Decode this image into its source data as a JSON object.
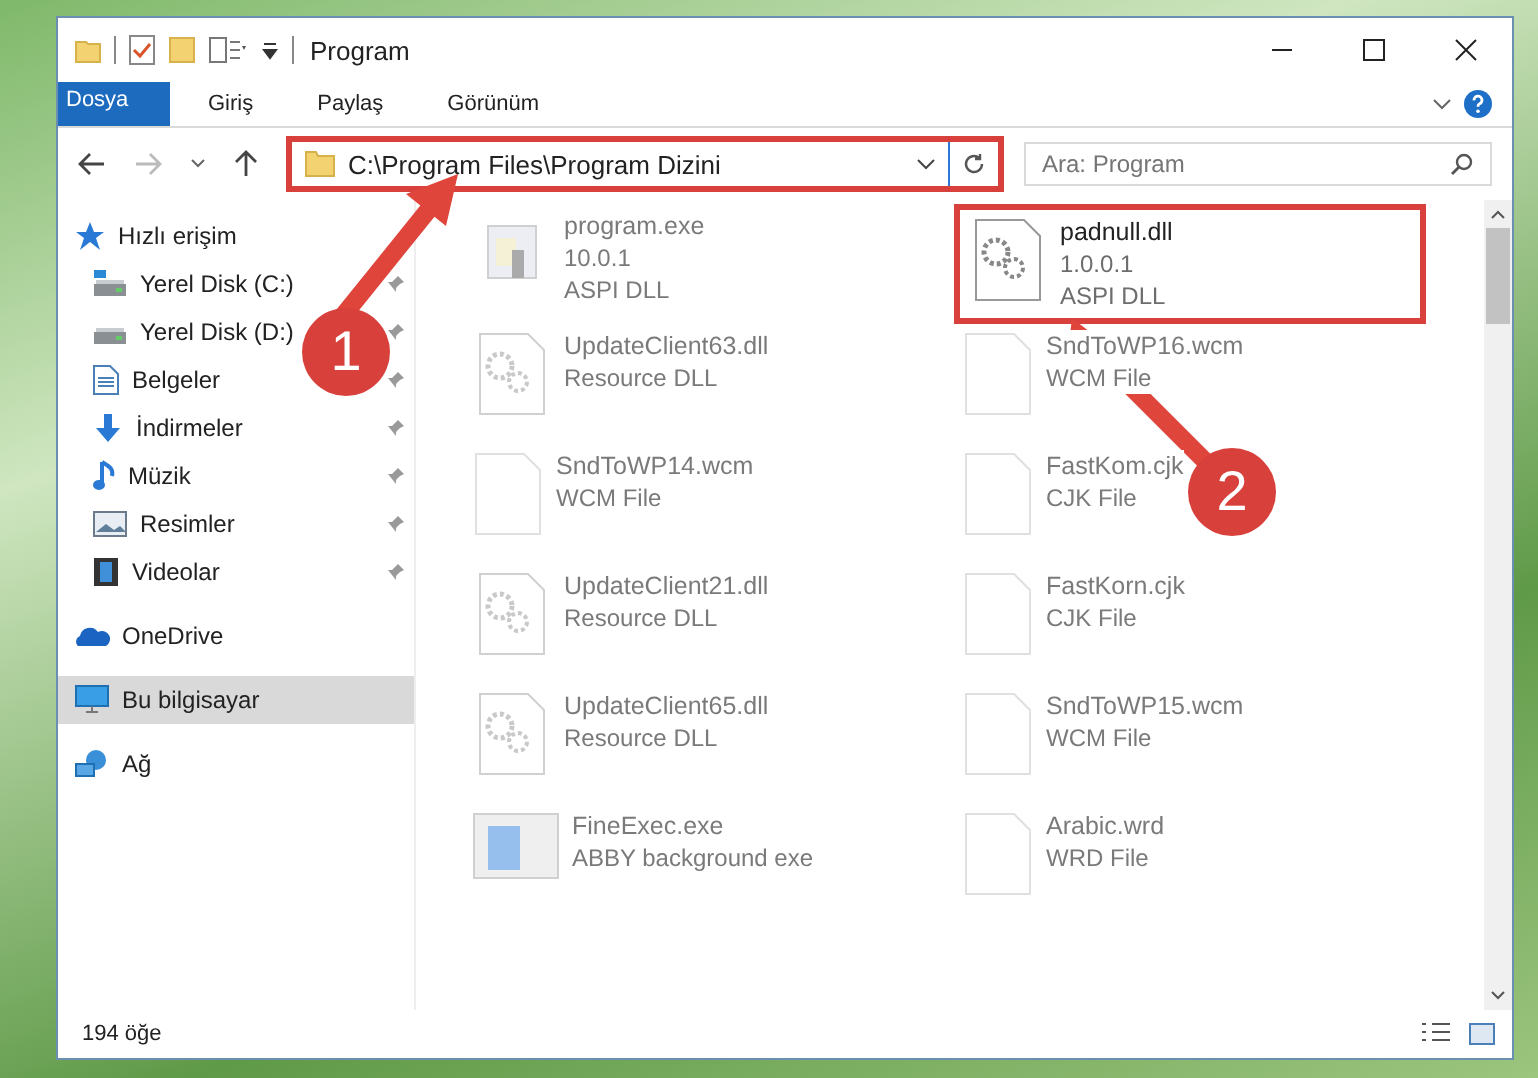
{
  "window": {
    "title": "Program"
  },
  "ribbon_tabs": [
    {
      "label": "Dosya",
      "kind": "file"
    },
    {
      "label": "Giriş",
      "kind": "tab"
    },
    {
      "label": "Paylaş",
      "kind": "tab"
    },
    {
      "label": "Görünüm",
      "kind": "tab"
    }
  ],
  "address_bar": {
    "path": "C:\\Program Files\\Program Dizini",
    "highlighted": true
  },
  "search": {
    "placeholder": "Ara: Program"
  },
  "sidebar": {
    "items": [
      {
        "label": "Hızlı erişim",
        "selected": false,
        "children": [
          {
            "label": "Yerel Disk (C:)",
            "pinned": true
          },
          {
            "label": "Yerel Disk (D:)",
            "pinned": true
          },
          {
            "label": "Belgeler",
            "pinned": true
          },
          {
            "label": "İndirmeler",
            "pinned": true
          },
          {
            "label": "Müzik",
            "pinned": true
          },
          {
            "label": "Resimler",
            "pinned": true
          },
          {
            "label": "Videolar",
            "pinned": true
          }
        ]
      },
      {
        "label": "OneDrive",
        "selected": false
      },
      {
        "label": "Bu bilgisayar",
        "selected": true
      },
      {
        "label": "Ağ",
        "selected": false
      }
    ]
  },
  "files": [
    {
      "name": "program.exe",
      "lines": [
        "10.0.1",
        "ASPI DLL"
      ],
      "kind": "exe",
      "highlighted": false
    },
    {
      "name": "padnull.dll",
      "lines": [
        "1.0.0.1",
        "ASPI DLL"
      ],
      "kind": "dll",
      "highlighted": true
    },
    {
      "name": "UpdateClient63.dll",
      "lines": [
        "Resource DLL"
      ],
      "kind": "dll",
      "highlighted": false
    },
    {
      "name": "SndToWP16.wcm",
      "lines": [
        "WCM File"
      ],
      "kind": "file",
      "highlighted": false
    },
    {
      "name": "SndToWP14.wcm",
      "lines": [
        "WCM File"
      ],
      "kind": "file",
      "highlighted": false
    },
    {
      "name": "FastKom.cjk",
      "lines": [
        "CJK File"
      ],
      "kind": "file",
      "highlighted": false
    },
    {
      "name": "UpdateClient21.dll",
      "lines": [
        "Resource DLL"
      ],
      "kind": "dll",
      "highlighted": false
    },
    {
      "name": "FastKorn.cjk",
      "lines": [
        "CJK File"
      ],
      "kind": "file",
      "highlighted": false
    },
    {
      "name": "UpdateClient65.dll",
      "lines": [
        "Resource DLL"
      ],
      "kind": "dll",
      "highlighted": false
    },
    {
      "name": "SndToWP15.wcm",
      "lines": [
        "WCM File"
      ],
      "kind": "file",
      "highlighted": false
    },
    {
      "name": "FineExec.exe",
      "lines": [
        "ABBY background exe"
      ],
      "kind": "app",
      "highlighted": false
    },
    {
      "name": "Arabic.wrd",
      "lines": [
        "WRD File"
      ],
      "kind": "file",
      "highlighted": false
    }
  ],
  "annotations": [
    {
      "number": "1"
    },
    {
      "number": "2"
    }
  ],
  "status_bar": {
    "count": "194 öğe"
  }
}
